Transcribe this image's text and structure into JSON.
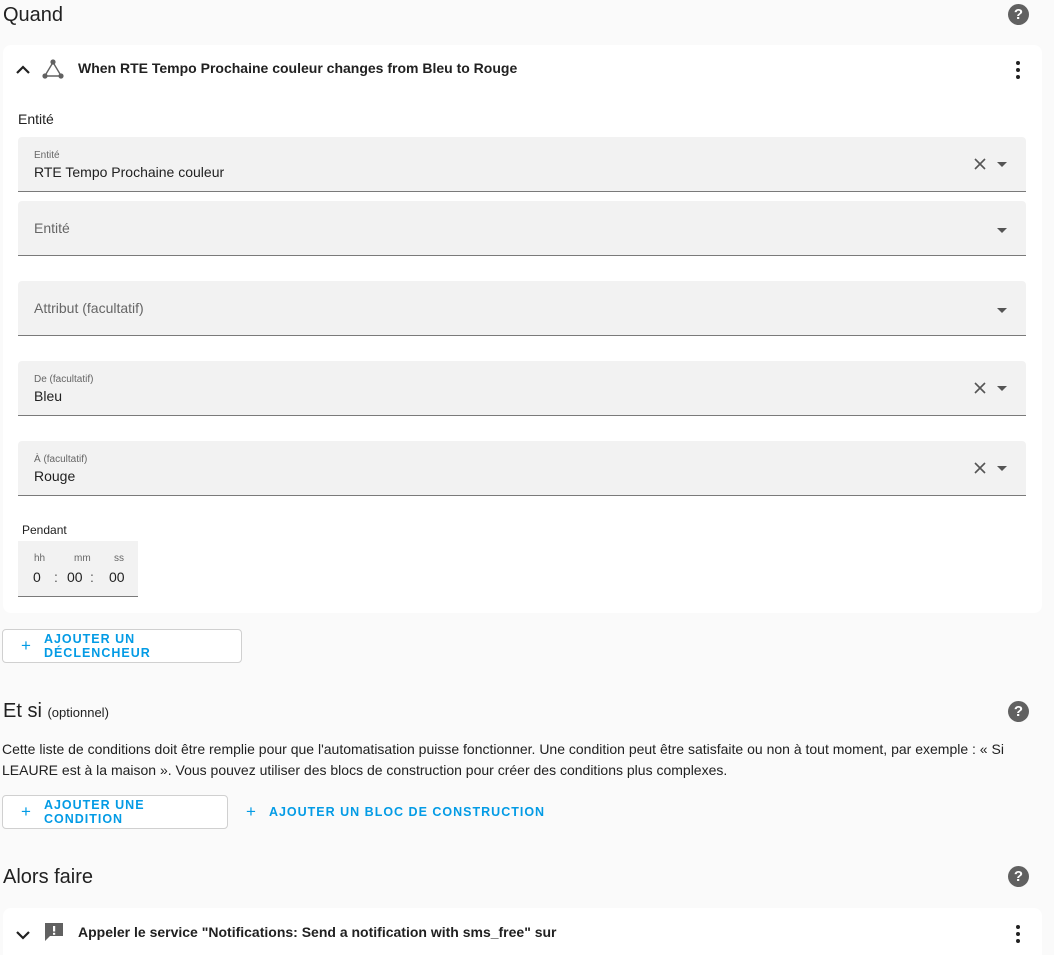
{
  "when_section": {
    "title": "Quand",
    "trigger": {
      "header": "When RTE Tempo Prochaine couleur changes from Bleu to Rouge",
      "entity_section_label": "Entité",
      "entity_field": {
        "label": "Entité",
        "value": "RTE Tempo Prochaine couleur"
      },
      "entity_empty": {
        "placeholder": "Entité"
      },
      "attribute_field": {
        "placeholder": "Attribut (facultatif)"
      },
      "from_field": {
        "label": "De (facultatif)",
        "value": "Bleu"
      },
      "to_field": {
        "label": "À (facultatif)",
        "value": "Rouge"
      },
      "duration": {
        "label": "Pendant",
        "hh_label": "hh",
        "mm_label": "mm",
        "ss_label": "ss",
        "hh": "0",
        "mm": "00",
        "ss": "00",
        "sep": ":"
      }
    },
    "add_trigger_button": "AJOUTER UN DÉCLENCHEUR"
  },
  "conditions_section": {
    "title": "Et si",
    "title_suffix": "(optionnel)",
    "description": "Cette liste de conditions doit être remplie pour que l'automatisation puisse fonctionner. Une condition peut être satisfaite ou non à tout moment, par exemple : « Si LEAURE est à la maison ». Vous pouvez utiliser des blocs de construction pour créer des conditions plus complexes.",
    "add_condition_button": "AJOUTER UNE CONDITION",
    "add_building_block_button": "AJOUTER UN BLOC DE CONSTRUCTION"
  },
  "actions_section": {
    "title": "Alors faire",
    "action": {
      "header": "Appeler le service \"Notifications: Send a notification with sms_free\" sur"
    }
  },
  "icons": {
    "help": "help-circle-icon",
    "trigger": "state-graph-icon",
    "action": "message-alert-icon",
    "menu": "dots-vertical-icon"
  },
  "colors": {
    "accent": "#039be5",
    "background": "#fafafa",
    "card": "#ffffff",
    "field_bg": "#f2f2f2"
  }
}
